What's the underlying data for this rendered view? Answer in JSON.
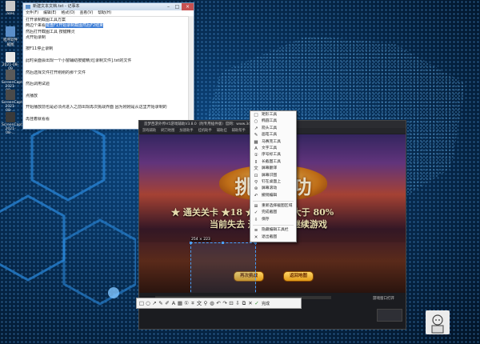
{
  "desktop": {
    "icons": [
      {
        "label": "ares",
        "icon": "app-icon"
      },
      {
        "label": "程序软件截图",
        "icon": "shortcut-icon"
      },
      {
        "label": "2021-08-09",
        "icon": "folder-icon"
      },
      {
        "label": "ScreenCapture 2021-08-...",
        "icon": "image-icon"
      },
      {
        "label": "ScreenCapture 2021-08-...",
        "icon": "image-icon"
      },
      {
        "label": "ScreenCapture 2021-08-...",
        "icon": "image-icon"
      }
    ]
  },
  "notepad": {
    "title": "新建文本文档.txt - 记事本",
    "menu": [
      "文件(F)",
      "编辑(E)",
      "格式(O)",
      "查看(V)",
      "帮助(H)"
    ],
    "lines": [
      {
        "pre": "打开录制截图工具方案",
        "sel": ""
      },
      {
        "pre": "两边个来看",
        "sel": "键盘F1开始录制截图然后F2结束"
      },
      {
        "pre": "然后打开截图工具 按键精灵",
        "sel": ""
      },
      {
        "pre": "点开始录制",
        "sel": ""
      },
      {
        "pre": "",
        "sel": ""
      },
      {
        "pre": "按F11停止录制",
        "sel": ""
      },
      {
        "pre": "",
        "sel": ""
      },
      {
        "pre": "此时桌面会出现一个小窗辅助按键精灵[录制文件].txt的文件",
        "sel": ""
      },
      {
        "pre": "",
        "sel": ""
      },
      {
        "pre": "然后选择文件打开刚刚的那个文件",
        "sel": ""
      },
      {
        "pre": "",
        "sel": ""
      },
      {
        "pre": "然后调用试验",
        "sel": ""
      },
      {
        "pre": "",
        "sel": ""
      },
      {
        "pre": "点播放",
        "sel": ""
      },
      {
        "pre": "",
        "sel": ""
      },
      {
        "pre": "开始播放前也是必须点进入之前出现再次挑战界面 因为刚刚是从这里开始录制的",
        "sel": ""
      },
      {
        "pre": "",
        "sel": ""
      },
      {
        "pre": "再挂着就看看",
        "sel": ""
      }
    ]
  },
  "app_window": {
    "title": "造梦西游外传H5游戏辅助V3.8.0（附专用插件版）官网：www.3dgt.cn",
    "menu": [
      "游戏辅助",
      "刷刀地图",
      "加速助手",
      "挂机助手",
      "辅助挂",
      "辅助帮手"
    ],
    "bottom_link": "游戏窗口打开"
  },
  "game": {
    "banner": "挑战成功",
    "line1": "★ 通关关卡 ★18 ★ 剩余生命大于 80%",
    "line2": "当前失去 通关挑战将继续游戏",
    "retry_button": "再次挑战",
    "map_button": "返回地图"
  },
  "capture": {
    "selection_size": "254 × 223",
    "toolbar_icons": [
      "rect-icon",
      "ellipse-icon",
      "arrow-icon",
      "pen-icon",
      "highlighter-icon",
      "text-icon",
      "mosaic-icon",
      "number-icon",
      "crop-icon",
      "translate-icon",
      "pin-icon",
      "blur-icon",
      "undo-icon",
      "redo-icon",
      "ocr-icon",
      "save-icon",
      "copy-icon",
      "cancel-icon"
    ],
    "done_label": "完成"
  },
  "context_menu": {
    "groups": [
      [
        {
          "label": "矩形工具",
          "icon": "rect-icon"
        },
        {
          "label": "椭圆工具",
          "icon": "ellipse-icon"
        },
        {
          "label": "箭头工具",
          "icon": "arrow-icon"
        },
        {
          "label": "画笔工具",
          "icon": "pen-icon"
        },
        {
          "label": "马赛克工具",
          "icon": "mosaic-icon"
        },
        {
          "label": "文字工具",
          "icon": "text-icon"
        },
        {
          "label": "序号标工具",
          "icon": "number-icon"
        },
        {
          "label": "长截图工具",
          "icon": "longshot-icon"
        },
        {
          "label": "屏幕翻译",
          "icon": "translate-icon"
        },
        {
          "label": "屏幕识图",
          "icon": "ocr-icon"
        },
        {
          "label": "钉在桌面上",
          "icon": "pin-icon"
        },
        {
          "label": "屏幕滚动",
          "icon": "scroll-icon"
        },
        {
          "label": "撤销编辑",
          "icon": "undo-icon"
        }
      ],
      [
        {
          "label": "重新选择截图区域",
          "icon": "reselect-icon"
        },
        {
          "label": "完成截图",
          "icon": "done-icon"
        },
        {
          "label": "保存",
          "icon": "save-icon"
        }
      ],
      [
        {
          "label": "隐藏编辑工具栏",
          "icon": "hide-icon"
        },
        {
          "label": "退出截图",
          "icon": "close-icon"
        }
      ]
    ]
  },
  "colors": {
    "desktop": "#0a3c72",
    "selection": "#4aa0ff",
    "accent": "#3a7bd5"
  }
}
